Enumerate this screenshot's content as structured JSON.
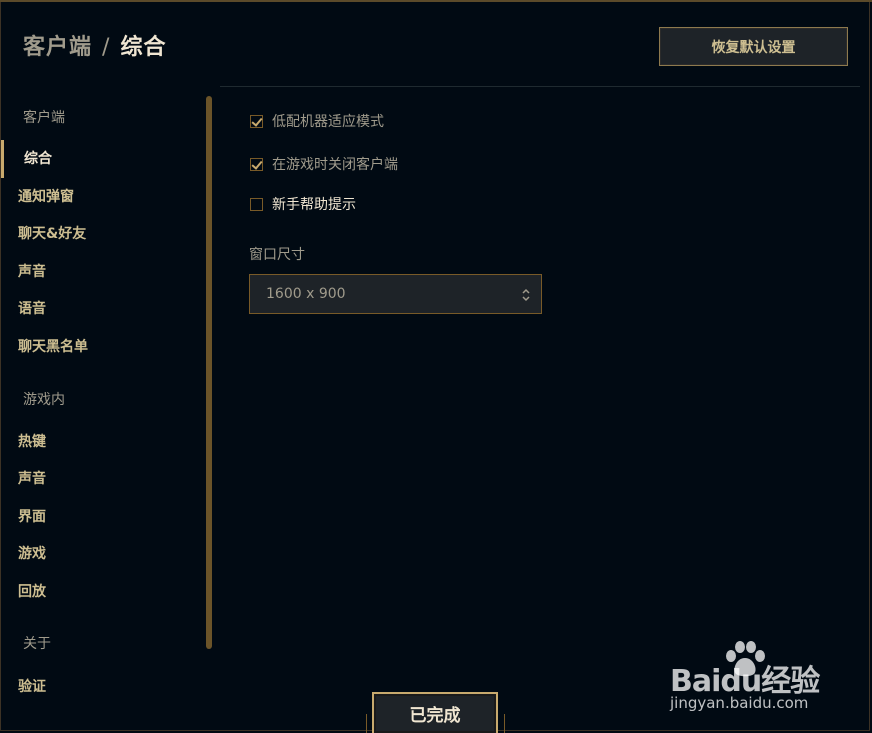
{
  "header": {
    "crumb": "客户端",
    "separator": "/",
    "current": "综合",
    "restore_label": "恢复默认设置"
  },
  "sidebar": {
    "sections": [
      {
        "title": "客户端",
        "items": [
          {
            "label": "综合",
            "active": true
          },
          {
            "label": "通知弹窗"
          },
          {
            "label": "聊天&好友"
          },
          {
            "label": "声音"
          },
          {
            "label": "语音"
          },
          {
            "label": "聊天黑名单"
          }
        ]
      },
      {
        "title": "游戏内",
        "items": [
          {
            "label": "热键"
          },
          {
            "label": "声音"
          },
          {
            "label": "界面"
          },
          {
            "label": "游戏"
          },
          {
            "label": "回放"
          }
        ]
      },
      {
        "title": "关于",
        "items": [
          {
            "label": "验证"
          }
        ]
      }
    ]
  },
  "settings": {
    "checkboxes": [
      {
        "label": "低配机器适应模式",
        "checked": true
      },
      {
        "label": "在游戏时关闭客户端",
        "checked": true
      },
      {
        "label": "新手帮助提示",
        "checked": false
      }
    ],
    "window_size": {
      "label": "窗口尺寸",
      "value": "1600 x 900"
    }
  },
  "footer": {
    "done_label": "已完成"
  },
  "watermark": {
    "brand": "Baidu经验",
    "url": "jingyan.baidu.com"
  },
  "colors": {
    "background": "#010a13",
    "gold": "#c8aa6e",
    "gold_dark": "#785a28",
    "text_light": "#f0e6d2",
    "text_muted": "#a09b8c"
  }
}
